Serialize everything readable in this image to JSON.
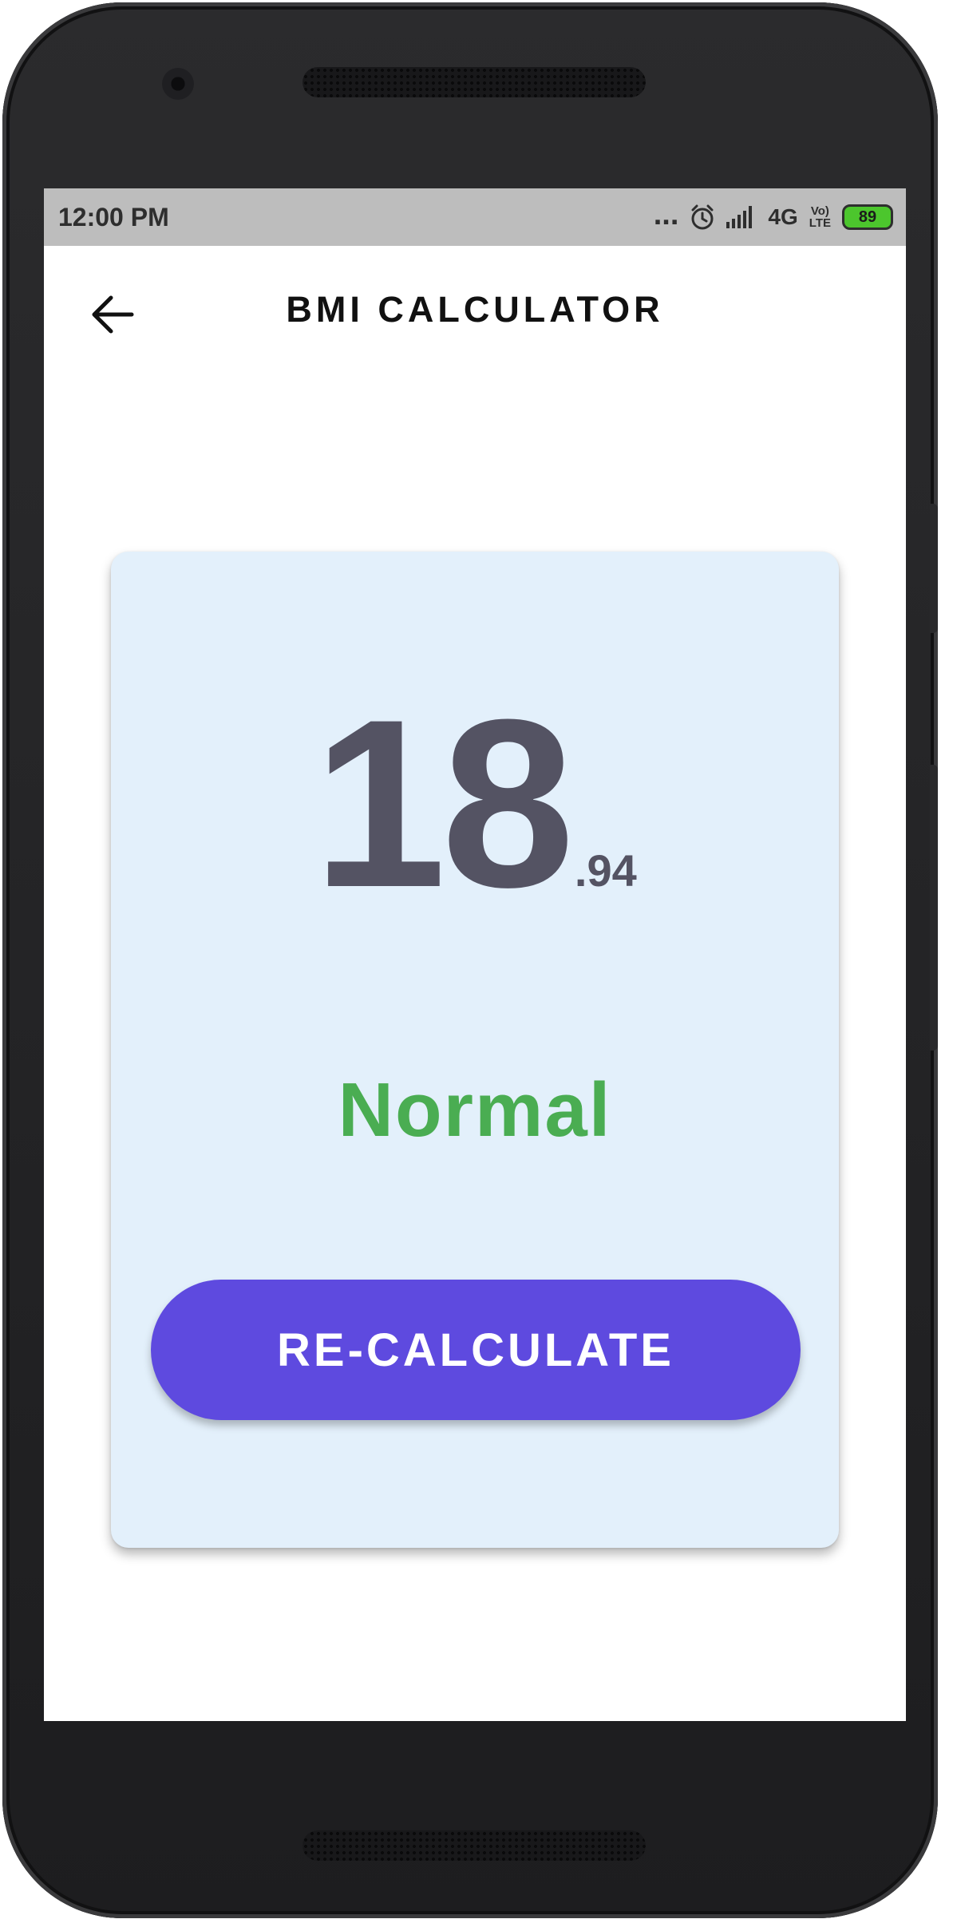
{
  "status_bar": {
    "time": "12:00 PM",
    "network": "4G",
    "volte_top": "Vo)",
    "volte_bottom": "LTE",
    "battery": "89",
    "battery_color": "#4cc62d"
  },
  "app_bar": {
    "title": "BMI CALCULATOR",
    "back_icon": "arrow-back-icon"
  },
  "result": {
    "bmi_integer": "18",
    "bmi_decimal": ".94",
    "category": "Normal",
    "category_color": "#4aad52",
    "card_color": "#e3f0fb"
  },
  "actions": {
    "recalculate_label": "RE-CALCULATE",
    "button_color": "#5e4adf"
  }
}
